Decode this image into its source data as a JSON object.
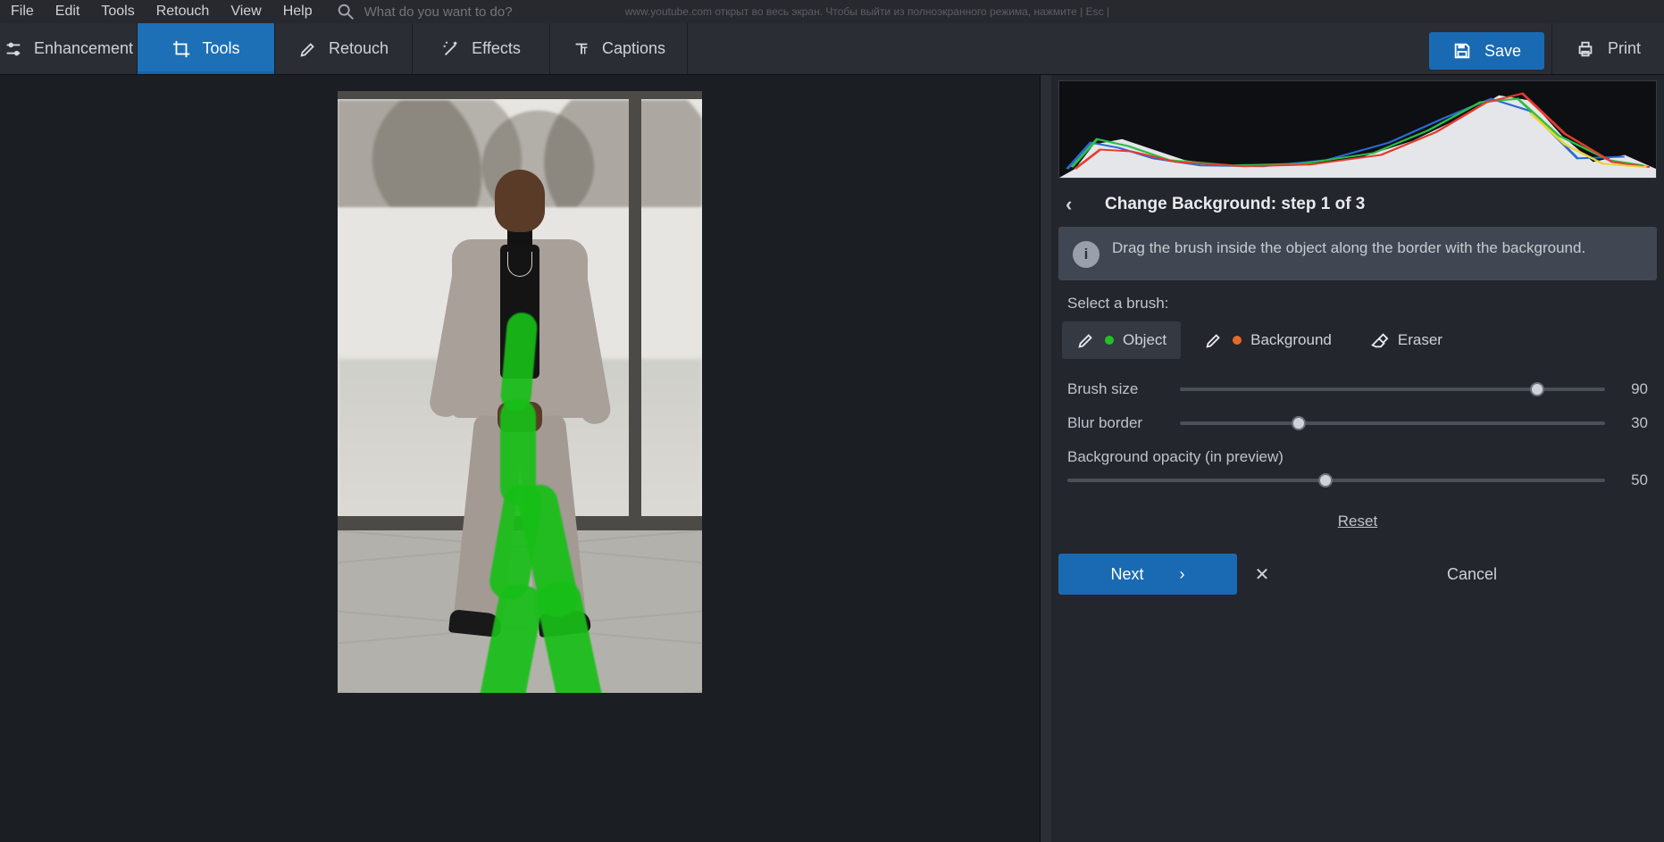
{
  "menu": {
    "items": [
      "File",
      "Edit",
      "Tools",
      "Retouch",
      "View",
      "Help"
    ],
    "search_placeholder": "What do you want to do?",
    "tail": "www.youtube.com открыт во весь экран. Чтобы выйти из полноэкранного режима, нажмите  | Esc |"
  },
  "toolbar": {
    "tabs": [
      {
        "label": "Enhancement",
        "icon": "sliders-icon"
      },
      {
        "label": "Tools",
        "icon": "crop-icon",
        "active": true
      },
      {
        "label": "Retouch",
        "icon": "brush-icon"
      },
      {
        "label": "Effects",
        "icon": "wand-icon"
      },
      {
        "label": "Captions",
        "icon": "text-icon"
      }
    ],
    "save": "Save",
    "print": "Print"
  },
  "panel": {
    "title": "Change Background: step 1 of 3",
    "hint": "Drag the brush inside the object along the border with the background.",
    "select_brush": "Select a brush:",
    "brushes": {
      "object": "Object",
      "background": "Background",
      "eraser": "Eraser"
    },
    "sliders": {
      "brush_size": {
        "label": "Brush size",
        "value": "90",
        "pct": 84
      },
      "blur_border": {
        "label": "Blur border",
        "value": "30",
        "pct": 28
      },
      "bg_opacity": {
        "label": "Background opacity (in preview)",
        "value": "50",
        "pct": 48
      }
    },
    "reset": "Reset",
    "next": "Next",
    "cancel": "Cancel"
  }
}
